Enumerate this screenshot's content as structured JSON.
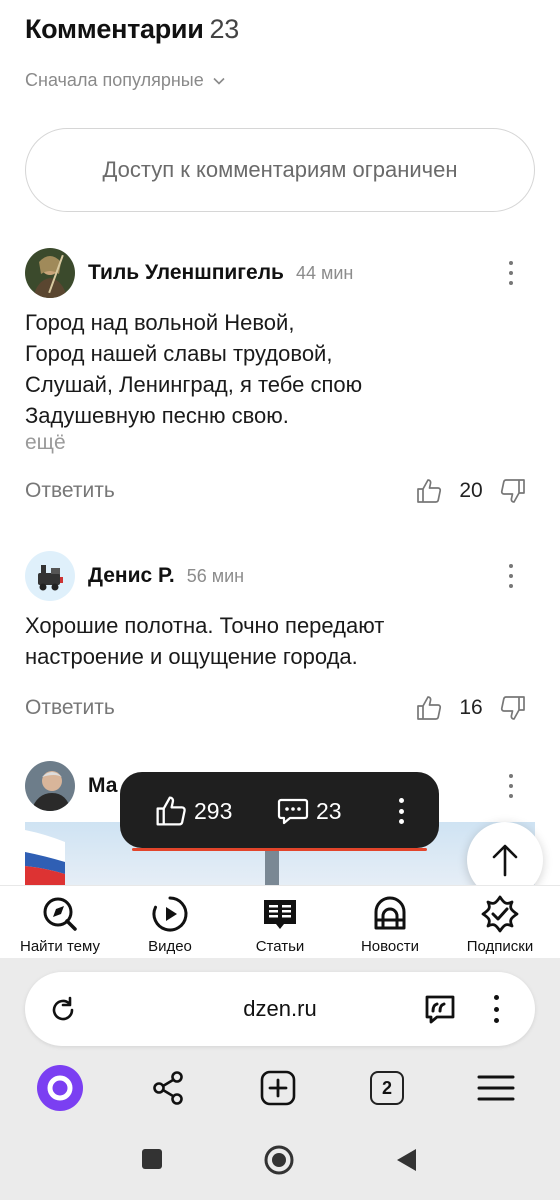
{
  "comments_header": {
    "title": "Комментарии",
    "count": "23"
  },
  "sort": {
    "label": "Сначала популярные"
  },
  "restricted": {
    "text": "Доступ к комментариям ограничен"
  },
  "comments": [
    {
      "author": "Тиль Уленшпигель",
      "time": "44 мин",
      "lines": [
        "Город над вольной Невой,",
        "Город нашей славы трудовой,",
        "Слушай, Ленинград, я тебе спою",
        "Задушевную песню свою."
      ],
      "more": "ещё",
      "reply": "Ответить",
      "likes": "20"
    },
    {
      "author": "Денис Р.",
      "time": "56 мин",
      "lines": [
        "Хорошие полотна. Точно передают",
        "настроение и ощущение города."
      ],
      "reply": "Ответить",
      "likes": "16"
    },
    {
      "author": "Ма"
    }
  ],
  "float_bar": {
    "likes": "293",
    "comments": "23"
  },
  "bottom_nav": [
    {
      "label": "Найти тему",
      "icon": "compass-icon"
    },
    {
      "label": "Видео",
      "icon": "video-icon"
    },
    {
      "label": "Статьи",
      "icon": "articles-icon"
    },
    {
      "label": "Новости",
      "icon": "news-icon"
    },
    {
      "label": "Подписки",
      "icon": "subscriptions-icon"
    }
  ],
  "browser": {
    "url": "dzen.ru",
    "tabs_count": "2"
  },
  "colors": {
    "accent_red": "#e2452b",
    "alice_purple": "#7b3ff2",
    "float_bg": "#1f1f1f"
  }
}
